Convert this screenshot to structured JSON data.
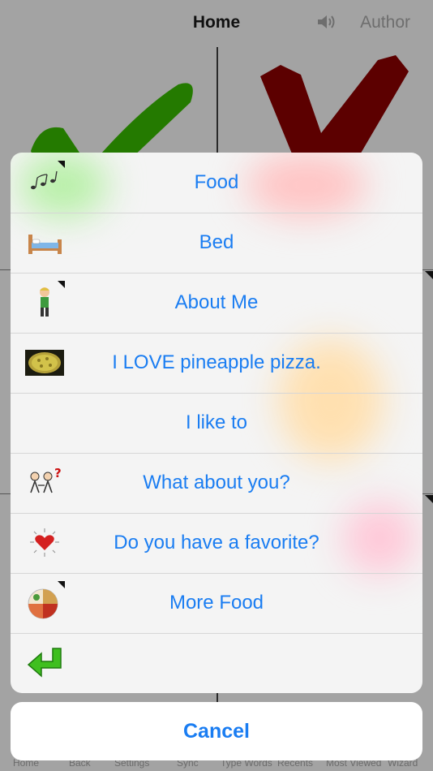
{
  "nav": {
    "title": "Home",
    "author": "Author"
  },
  "menu": {
    "items": [
      {
        "label": "Food",
        "icon": "music-notes-icon",
        "submenu": true
      },
      {
        "label": "Bed",
        "icon": "bed-icon",
        "submenu": false
      },
      {
        "label": "About Me",
        "icon": "boy-icon",
        "submenu": true
      },
      {
        "label": "I LOVE pineapple pizza.",
        "icon": "pizza-photo-icon",
        "submenu": false
      },
      {
        "label": "I like to",
        "icon": "",
        "submenu": false
      },
      {
        "label": "What about you?",
        "icon": "people-question-icon",
        "submenu": false
      },
      {
        "label": "Do you have a favorite?",
        "icon": "heart-icon",
        "submenu": false
      },
      {
        "label": "More Food",
        "icon": "food-plate-icon",
        "submenu": true
      },
      {
        "label": "",
        "icon": "back-arrow-icon",
        "submenu": false
      }
    ],
    "cancel_label": "Cancel"
  },
  "tabbar": {
    "items": [
      "Home",
      "Back",
      "Settings",
      "Sync",
      "Type Words",
      "Recents",
      "Most Viewed",
      "Wizard"
    ]
  },
  "colors": {
    "accent": "#1a7df2",
    "check_green": "#247a00",
    "check_red": "#5c0000"
  }
}
